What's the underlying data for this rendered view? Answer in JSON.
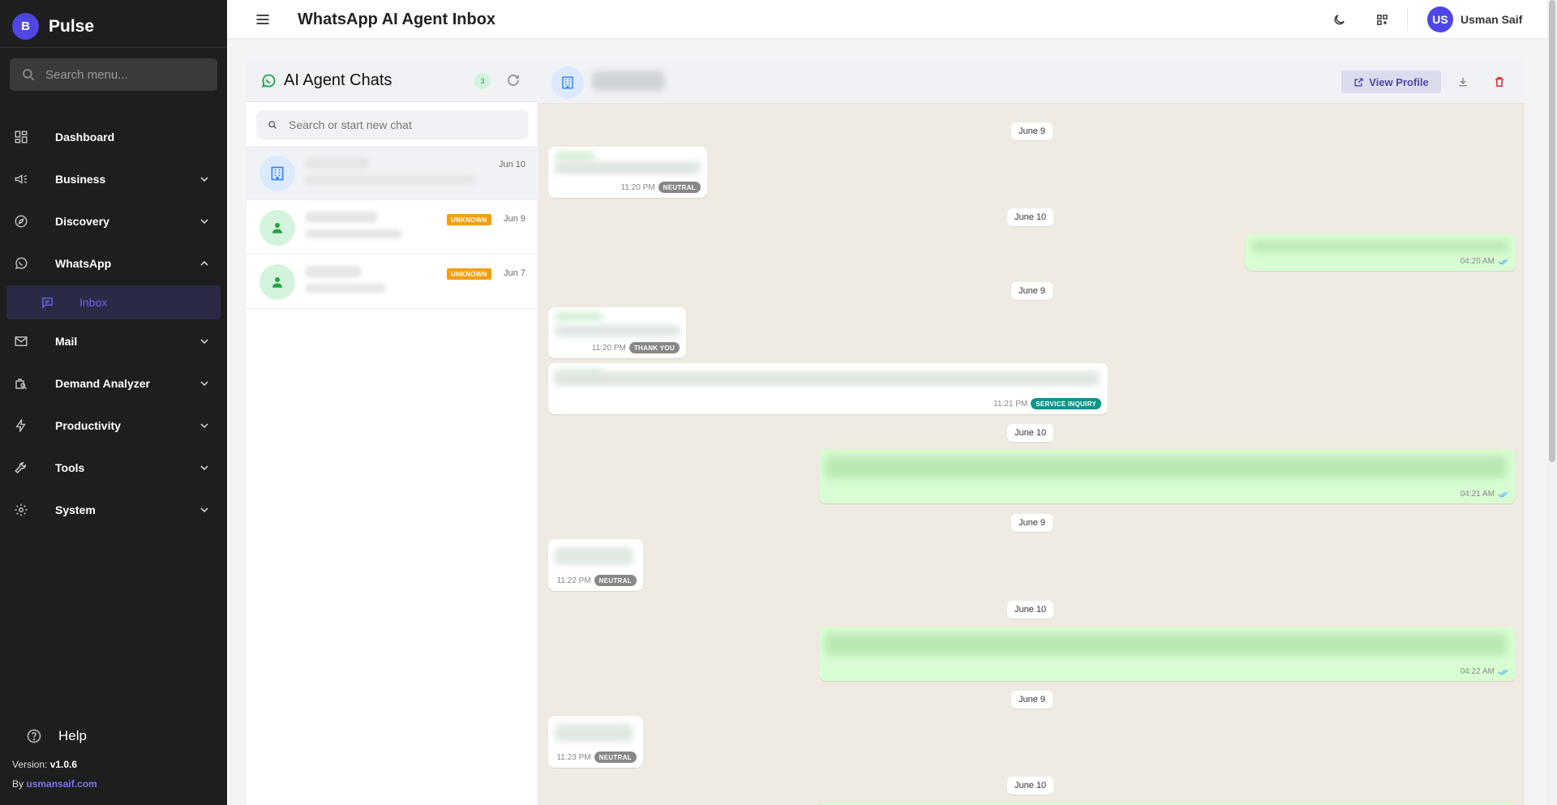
{
  "app": {
    "brand_initial": "B",
    "brand_name": "Pulse",
    "page_title": "WhatsApp AI Agent Inbox"
  },
  "sidebar": {
    "search_placeholder": "Search menu...",
    "items": [
      {
        "label": "Dashboard",
        "icon": "dashboard-icon"
      },
      {
        "label": "Business",
        "icon": "megaphone-icon"
      },
      {
        "label": "Discovery",
        "icon": "compass-icon"
      },
      {
        "label": "WhatsApp",
        "icon": "whatsapp-icon"
      },
      {
        "label": "Mail",
        "icon": "mail-icon"
      },
      {
        "label": "Demand Analyzer",
        "icon": "search-analyze-icon"
      },
      {
        "label": "Productivity",
        "icon": "bolt-icon"
      },
      {
        "label": "Tools",
        "icon": "wrench-icon"
      },
      {
        "label": "System",
        "icon": "gear-icon"
      }
    ],
    "sub_item": {
      "label": "Inbox",
      "icon": "chat-icon"
    },
    "help_label": "Help",
    "version_label": "Version:",
    "version_value": "v1.0.6",
    "by_label": "By",
    "by_link": "usmansaif.com"
  },
  "header": {
    "user_initials": "US",
    "user_name": "Usman Saif"
  },
  "chat_list": {
    "title": "AI Agent Chats",
    "count": "3",
    "search_placeholder": "Search or start new chat",
    "chats": [
      {
        "date": "Jun 10",
        "badge": ""
      },
      {
        "date": "Jun 9",
        "badge": "UNKNOWN"
      },
      {
        "date": "Jun 7",
        "badge": "UNKNOWN"
      }
    ]
  },
  "conversation": {
    "view_profile_label": "View Profile",
    "dates": [
      "June 9",
      "June 10",
      "June 9",
      "June 10",
      "June 9",
      "June 10",
      "June 9",
      "June 10"
    ],
    "messages": [
      {
        "time": "11:20 PM",
        "tag": "NEUTRAL"
      },
      {
        "time": "04:20 AM",
        "tag": ""
      },
      {
        "time": "11:20 PM",
        "tag": "THANK YOU"
      },
      {
        "time": "11:21 PM",
        "tag": "SERVICE INQUIRY"
      },
      {
        "time": "04:21 AM",
        "tag": ""
      },
      {
        "time": "11:22 PM",
        "tag": "NEUTRAL"
      },
      {
        "time": "04:22 AM",
        "tag": ""
      },
      {
        "time": "11:23 PM",
        "tag": "NEUTRAL"
      }
    ]
  },
  "colors": {
    "accent": "#4f46e5",
    "sidebar_bg": "#1e1e1e",
    "chat_bg": "#efeae2",
    "outgoing_bubble": "#d9fdd3",
    "unknown_badge": "#f59e0b",
    "service_tag": "#0d9488"
  }
}
